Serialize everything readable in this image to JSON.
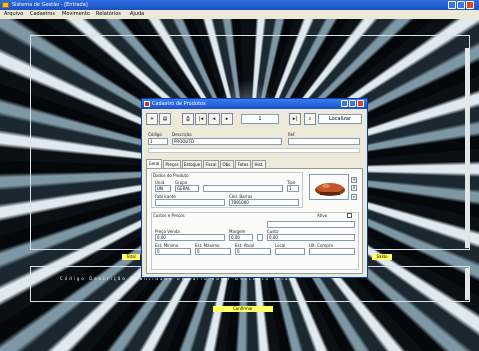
{
  "app": {
    "title": "Sistema de Gestão - [Entrada]",
    "menu": [
      "Arquivo",
      "Cadastros",
      "Movimento",
      "Relatórios",
      "Ajuda"
    ]
  },
  "background": {
    "yellow_tags": [
      "Total",
      "Saldo",
      "Confirmar"
    ],
    "strip_text": "Código   Descrição   Quantidade   Unitário   Valor   Desconto   Total"
  },
  "dialog": {
    "title": "Cadastro de Produtos",
    "toolbar": {
      "new": "+",
      "save": "▤",
      "print": "⎙",
      "first": "|◂",
      "prev": "◂",
      "record_field": "1",
      "next": "▸",
      "last": "▸|",
      "search_label": "Localizar"
    },
    "header_fields": {
      "code_label": "Código",
      "code_value": "1",
      "description_label": "Descrição",
      "description_value": "PRODUTO",
      "ref_label": "Ref.",
      "ref_value": ""
    },
    "tabs": [
      "Geral",
      "Preços",
      "Estoque",
      "Fiscal",
      "Obs.",
      "Fotos",
      "Hist."
    ],
    "active_tab": 0,
    "panel": {
      "group_label": "Dados do Produto",
      "unit_label": "Unid.",
      "unit_value": "UN",
      "group_value_label": "Grupo",
      "group_value": "GERAL",
      "type_label": "Tipo",
      "type_value": "1",
      "manufacturer_label": "Fabricante",
      "manufacturer_value": "",
      "barcode_label": "Cód. Barras",
      "barcode_value": "7891000",
      "cost_section_label": "Custos e Preços",
      "active_label": "Ativo",
      "price_label": "Preço Venda",
      "price_value": "0,00",
      "margin_label": "Margem",
      "margin_value": "0,00",
      "cost_label": "Custo",
      "cost_value": "0,00",
      "min_label": "Est. Mínimo",
      "min_value": "0",
      "max_label": "Est. Máximo",
      "max_value": "0",
      "current_label": "Est. Atual",
      "current_value": "0",
      "location_label": "Local",
      "location_value": "",
      "last_label": "Últ. Compra",
      "last_value": ""
    }
  }
}
